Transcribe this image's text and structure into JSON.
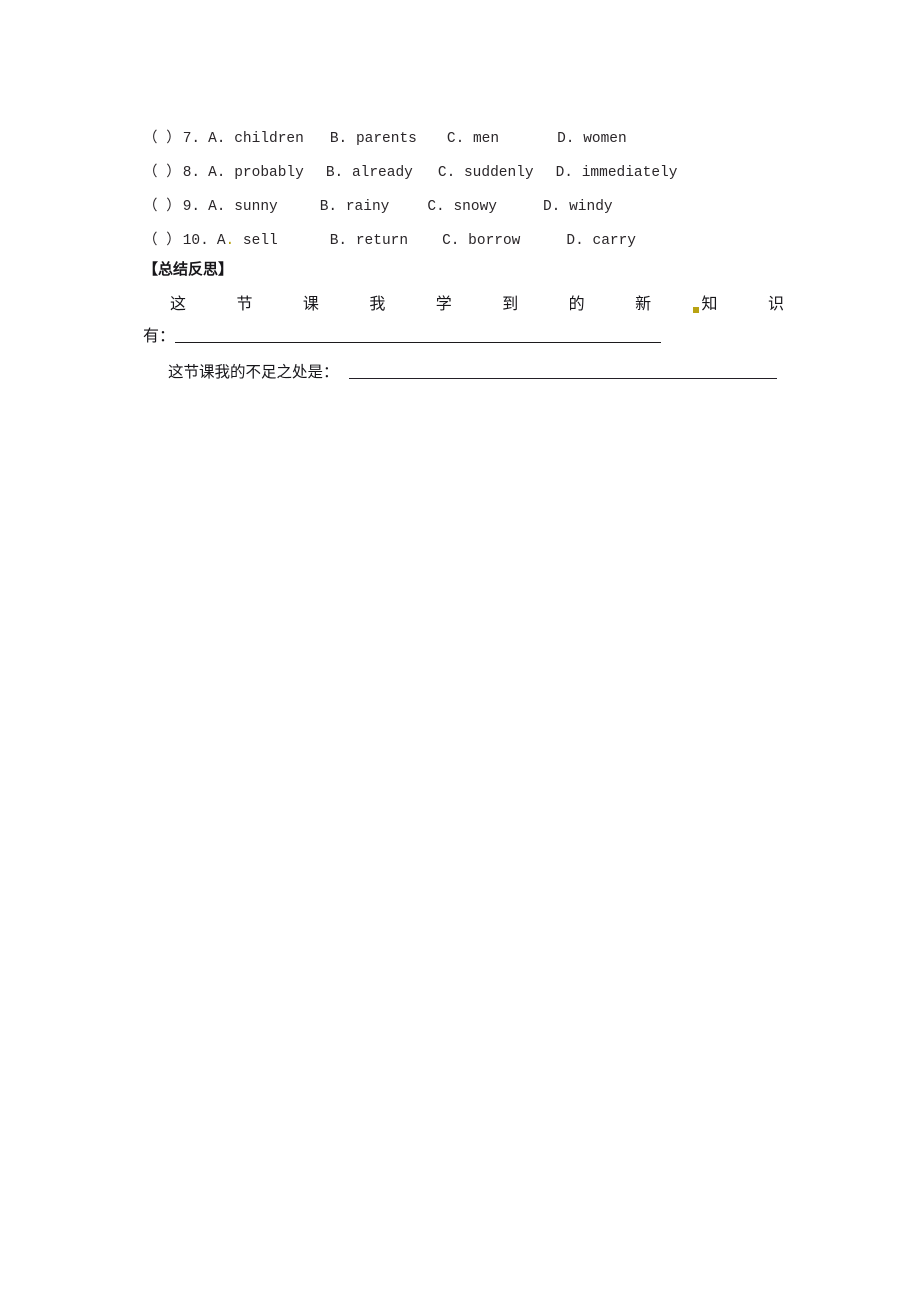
{
  "document": {
    "questions": [
      {
        "bracket": "（   ）",
        "number": "7.",
        "options": [
          {
            "letter": "A.",
            "text": "children"
          },
          {
            "letter": "B.",
            "text": "parents"
          },
          {
            "letter": "C.",
            "text": "men"
          },
          {
            "letter": "D.",
            "text": "women"
          }
        ]
      },
      {
        "bracket": "（   ）",
        "number": "8.",
        "options": [
          {
            "letter": "A.",
            "text": "probably"
          },
          {
            "letter": "B.",
            "text": "already"
          },
          {
            "letter": "C.",
            "text": "suddenly"
          },
          {
            "letter": "D.",
            "text": "immediately"
          }
        ]
      },
      {
        "bracket": "（   ）",
        "number": "9.",
        "options": [
          {
            "letter": "A.",
            "text": "sunny"
          },
          {
            "letter": "B.",
            "text": "rainy"
          },
          {
            "letter": "C.",
            "text": "snowy"
          },
          {
            "letter": "D.",
            "text": "windy"
          }
        ]
      },
      {
        "bracket": "（   ）",
        "number": "10.",
        "options": [
          {
            "letter": "A",
            "letter_dot": ".",
            "text": "sell"
          },
          {
            "letter": "B.",
            "text": "return"
          },
          {
            "letter": "C.",
            "text": "borrow"
          },
          {
            "letter": "D.",
            "text": "carry"
          }
        ]
      }
    ],
    "section_heading": "【总结反思】",
    "reflection": {
      "line1_chars": [
        "这",
        "节",
        "课",
        "我",
        "学",
        "到",
        "的",
        "新",
        "知",
        "识"
      ],
      "line1_continuation": "有：",
      "line2_prompt": "这节课我的不足之处是："
    }
  },
  "colors": {
    "page_background": "#ffffff",
    "text": "#231f20",
    "heading": "#17161a",
    "rule": "#1c1a1d",
    "scan_artifact": "#b9a313"
  }
}
